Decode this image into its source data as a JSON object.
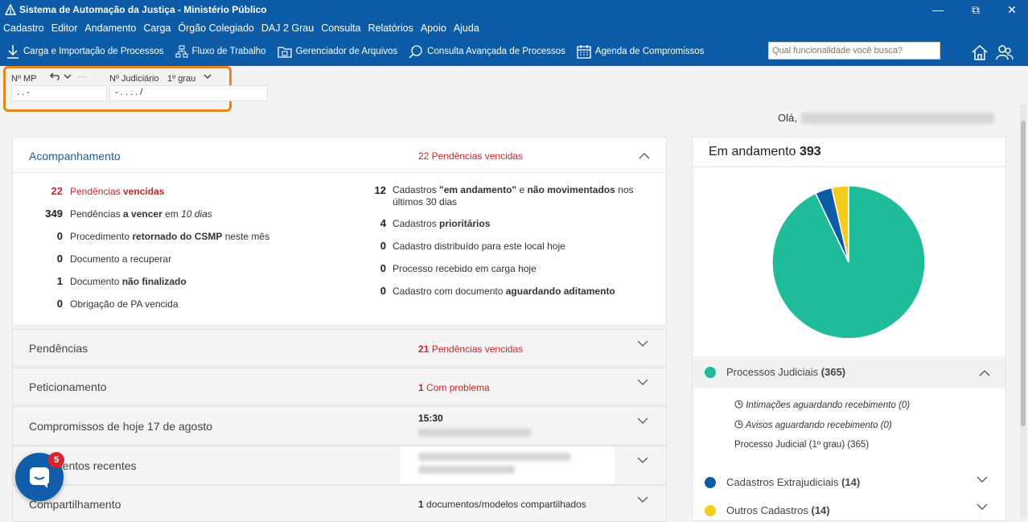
{
  "window": {
    "title": "Sistema de Automação da Justiça - Ministério Público",
    "minimize": "—",
    "maximize": "⧉",
    "close": "✕"
  },
  "menu": [
    "Cadastro",
    "Editor",
    "Andamento",
    "Carga",
    "Órgão Colegiado",
    "DAJ 2 Grau",
    "Consulta",
    "Relatórios",
    "Apoio",
    "Ajuda"
  ],
  "toolbar": {
    "carga": "Carga e Importação de Processos",
    "fluxo": "Fluxo de Trabalho",
    "gerenciador": "Gerenciador de Arquivos",
    "consulta": "Consulta Avançada de Processos",
    "agenda": "Agenda de Compromissos",
    "search_placeholder": "Qual funcionalidade você busca?"
  },
  "fields": {
    "nmp_label": "Nº MP",
    "nmp_more": "···",
    "nmp_value": ".   .         -",
    "njud_label": "Nº Judiciário",
    "grau": "1º grau",
    "njud_value": "-   .    .   . .   /"
  },
  "greeting": "Olá,",
  "acompanhamento": {
    "title": "Acompanhamento",
    "summary": "22 Pendências vencidas",
    "left": [
      {
        "num": "22",
        "text": "Pendências vencidas"
      },
      {
        "num": "349",
        "text": "Pendências a vencer em 10 dias"
      },
      {
        "num": "0",
        "text": "Procedimento retornado do CSMP neste mês"
      },
      {
        "num": "0",
        "text": "Documento a recuperar"
      },
      {
        "num": "1",
        "text": "Documento não finalizado"
      },
      {
        "num": "0",
        "text": "Obrigação de PA vencida"
      }
    ],
    "right": [
      {
        "num": "12",
        "text": "Cadastros \"em andamento\" e não movimentados nos",
        "text2": "últimos 30 dias"
      },
      {
        "num": "4",
        "text": "Cadastros prioritários"
      },
      {
        "num": "0",
        "text": "Cadastro distribuído para este local hoje"
      },
      {
        "num": "0",
        "text": "Processo recebido em carga hoje"
      },
      {
        "num": "0",
        "text": "Cadastro com documento aguardando aditamento"
      }
    ]
  },
  "panels": {
    "pendencias": {
      "title": "Pendências",
      "num": "21",
      "summary": "Pendências vencidas"
    },
    "peticionamento": {
      "title": "Peticionamento",
      "num": "1",
      "summary": "Com problema"
    },
    "compromissos": {
      "title": "Compromissos de hoje 17 de agosto",
      "time": "15:30"
    },
    "recentes": {
      "title": "mentos recentes"
    },
    "compartilhamento": {
      "title": "Compartilhamento",
      "num": "1",
      "summary": "documentos/modelos compartilhados"
    }
  },
  "chat_badge": "5",
  "andamento": {
    "title": "Em andamento",
    "total": "393",
    "legend": [
      {
        "label": "Processos Judiciais",
        "count": "(365)",
        "color": "#20bb99"
      },
      {
        "label": "Cadastros Extrajudiciais",
        "count": "(14)",
        "color": "#0c5ba6"
      },
      {
        "label": "Outros Cadastros",
        "count": "(14)",
        "color": "#f5cc1d"
      }
    ],
    "sub": [
      "Intimações aguardando recebimento (0)",
      "Avisos aguardando recebimento (0)",
      "Processo Judicial (1º grau) (365)"
    ]
  },
  "chart_data": {
    "type": "pie",
    "categories": [
      "Processos Judiciais",
      "Cadastros Extrajudiciais",
      "Outros Cadastros"
    ],
    "values": [
      365,
      14,
      14
    ],
    "colors": [
      "#20bb99",
      "#0c5ba6",
      "#f5cc1d"
    ]
  }
}
